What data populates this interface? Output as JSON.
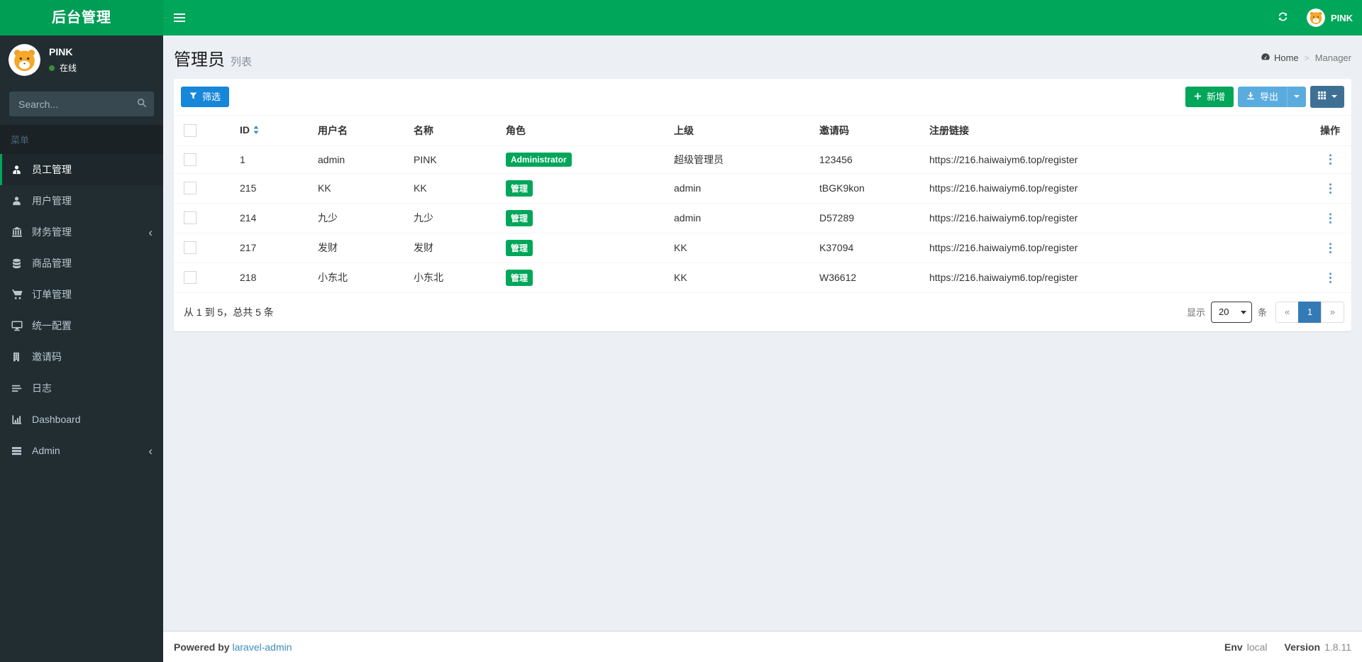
{
  "app": {
    "logo_title": "后台管理"
  },
  "navbar": {
    "user_name": "PINK"
  },
  "sidebar": {
    "user": {
      "name": "PINK",
      "status": "在线"
    },
    "search_placeholder": "Search...",
    "menu_header": "菜单",
    "items": [
      {
        "id": "staff",
        "label": "员工管理",
        "icon": "staff-icon",
        "active": true,
        "chevron": false
      },
      {
        "id": "users",
        "label": "用户管理",
        "icon": "user-icon",
        "active": false,
        "chevron": false
      },
      {
        "id": "finance",
        "label": "财务管理",
        "icon": "bank-icon",
        "active": false,
        "chevron": true
      },
      {
        "id": "goods",
        "label": "商品管理",
        "icon": "database-icon",
        "active": false,
        "chevron": false
      },
      {
        "id": "orders",
        "label": "订单管理",
        "icon": "cart-icon",
        "active": false,
        "chevron": false
      },
      {
        "id": "config",
        "label": "统一配置",
        "icon": "desktop-icon",
        "active": false,
        "chevron": false
      },
      {
        "id": "invite",
        "label": "邀请码",
        "icon": "building-icon",
        "active": false,
        "chevron": false
      },
      {
        "id": "logs",
        "label": "日志",
        "icon": "list-lines-icon",
        "active": false,
        "chevron": false
      },
      {
        "id": "dashboard",
        "label": "Dashboard",
        "icon": "bar-chart-icon",
        "active": false,
        "chevron": false
      },
      {
        "id": "admin",
        "label": "Admin",
        "icon": "tasks-icon",
        "active": false,
        "chevron": true
      }
    ]
  },
  "content_header": {
    "title": "管理员",
    "subtitle": "列表",
    "breadcrumb": [
      "Home",
      "Manager"
    ]
  },
  "toolbar": {
    "filter_label": "筛选",
    "new_label": "新增",
    "export_label": "导出"
  },
  "table": {
    "headers": [
      "ID",
      "用户名",
      "名称",
      "角色",
      "上级",
      "邀请码",
      "注册链接",
      "操作"
    ],
    "rows": [
      {
        "id": "1",
        "username": "admin",
        "name": "PINK",
        "role": "Administrator",
        "parent": "超级管理员",
        "invite_code": "123456",
        "register_link": "https://216.haiwaiym6.top/register"
      },
      {
        "id": "215",
        "username": "KK",
        "name": "KK",
        "role": "管理",
        "parent": "admin",
        "invite_code": "tBGK9kon",
        "register_link": "https://216.haiwaiym6.top/register"
      },
      {
        "id": "214",
        "username": "九少",
        "name": "九少",
        "role": "管理",
        "parent": "admin",
        "invite_code": "D57289",
        "register_link": "https://216.haiwaiym6.top/register"
      },
      {
        "id": "217",
        "username": "发财",
        "name": "发财",
        "role": "管理",
        "parent": "KK",
        "invite_code": "K37094",
        "register_link": "https://216.haiwaiym6.top/register"
      },
      {
        "id": "218",
        "username": "小东北",
        "name": "小东北",
        "role": "管理",
        "parent": "KK",
        "invite_code": "W36612",
        "register_link": "https://216.haiwaiym6.top/register"
      }
    ]
  },
  "pagination": {
    "summary": "从 1 到 5，总共 5 条",
    "show_label": "显示",
    "per_page": "20",
    "unit_label": "条",
    "pages": [
      {
        "label": "«",
        "active": false,
        "disabled": true
      },
      {
        "label": "1",
        "active": true,
        "disabled": false
      },
      {
        "label": "»",
        "active": false,
        "disabled": true
      }
    ]
  },
  "footer": {
    "powered_by": "Powered by",
    "powered_link": "laravel-admin",
    "env_label": "Env",
    "env_value": "local",
    "version_label": "Version",
    "version_value": "1.8.11"
  },
  "colors": {
    "brand_green": "#00a65a",
    "filter_blue": "#1787d9",
    "export_blue": "#5bacde",
    "grid_dark_blue": "#3e7095",
    "active_page_blue": "#337ab7",
    "link_blue": "#3c8dbc",
    "badge_green": "#00a65a",
    "sidebar_bg": "#222d32"
  }
}
